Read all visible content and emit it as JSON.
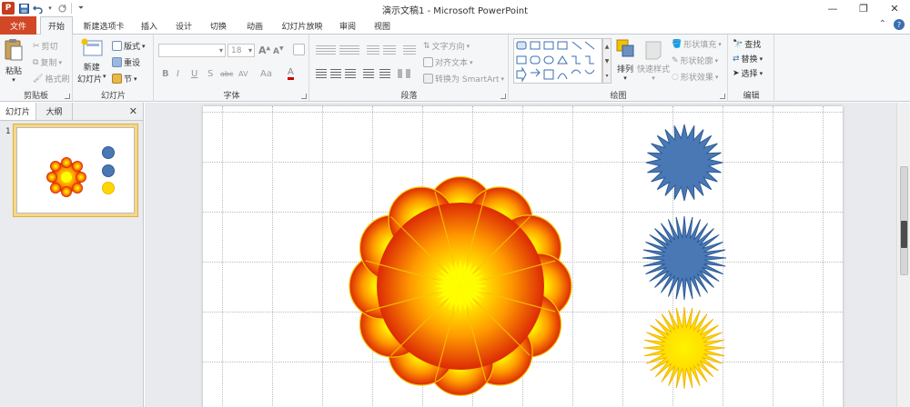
{
  "window": {
    "title": "演示文稿1 - Microsoft PowerPoint",
    "app_logo": "P",
    "controls": {
      "minimize": "—",
      "restore": "❐",
      "close": "✕"
    }
  },
  "quick_access": {
    "save": "💾",
    "undo": "↶",
    "redo": "↷",
    "customize": "⏷"
  },
  "tabs": {
    "file": "文件",
    "items": [
      "开始",
      "新建选项卡",
      "插入",
      "设计",
      "切换",
      "动画",
      "幻灯片放映",
      "审阅",
      "视图"
    ],
    "active": "开始"
  },
  "ribbon": {
    "clipboard": {
      "label": "剪贴板",
      "paste": "粘贴",
      "cut": "剪切",
      "copy": "复制",
      "format_painter": "格式刷"
    },
    "slides": {
      "label": "幻灯片",
      "new_slide": "新建",
      "new_slide_2": "幻灯片",
      "layout": "版式",
      "reset": "重设",
      "section": "节"
    },
    "font": {
      "label": "字体",
      "font_name": "",
      "font_size": "18",
      "bold": "B",
      "italic": "I",
      "underline": "U",
      "strike": "S",
      "abc": "abc",
      "spacing": "AV",
      "case": "Aa",
      "grow": "A",
      "shrink": "A"
    },
    "paragraph": {
      "label": "段落",
      "text_direction": "文字方向",
      "align_text": "对齐文本",
      "smartart": "转换为 SmartArt"
    },
    "drawing": {
      "label": "绘图",
      "arrange": "排列",
      "quick_styles": "快速样式",
      "shape_fill": "形状填充",
      "shape_outline": "形状轮廓",
      "shape_effects": "形状效果"
    },
    "editing": {
      "label": "编辑",
      "find": "查找",
      "replace": "替换",
      "select": "选择"
    }
  },
  "left_panel": {
    "tab_slides": "幻灯片",
    "tab_outline": "大纲",
    "close": "✕",
    "slide_number": "1"
  },
  "colors": {
    "file_tab": "#d24726",
    "flower_outer": "#d81e06",
    "flower_mid": "#ff9900",
    "flower_center": "#ffff00",
    "flower_stroke": "#f5c400",
    "star_blue": "#4a78b5",
    "star_blue_stroke": "#2e5c95",
    "star_yellow": "#ffd700",
    "star_yellow_stroke": "#f0b800"
  }
}
